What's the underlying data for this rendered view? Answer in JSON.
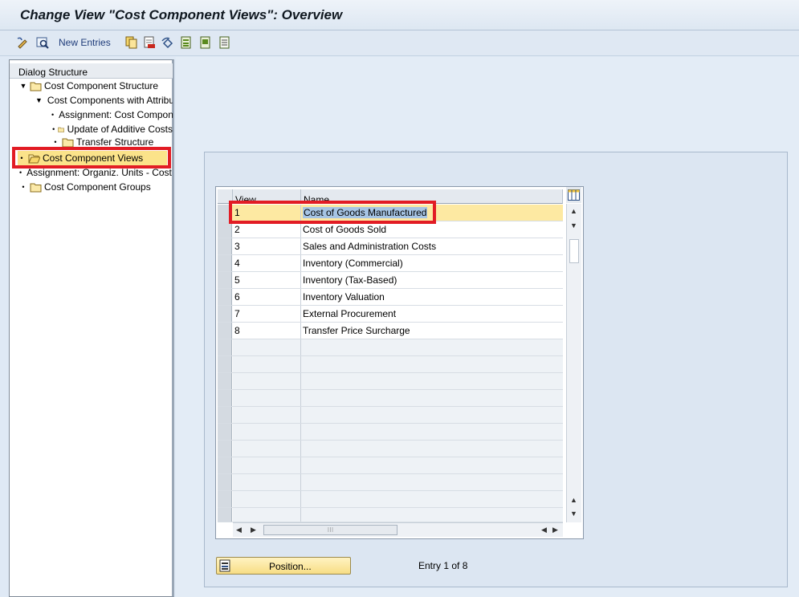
{
  "window": {
    "title": "Change View \"Cost Component Views\": Overview"
  },
  "toolbar": {
    "new_entries_label": "New Entries"
  },
  "dialog_structure": {
    "header": "Dialog Structure",
    "items": [
      {
        "label": "Cost Component Structure",
        "marker": "▼"
      },
      {
        "label": "Cost Components with Attributes",
        "marker": "▼"
      },
      {
        "label": "Assignment: Cost Components",
        "marker": "•"
      },
      {
        "label": "Update of Additive Costs",
        "marker": "•"
      },
      {
        "label": "Transfer Structure",
        "marker": "•"
      },
      {
        "label": "Cost Component Views",
        "marker": "•"
      },
      {
        "label": "Assignment: Organiz. Units - Cost Component Structure",
        "marker": "•"
      },
      {
        "label": "Cost Component Groups",
        "marker": "•"
      }
    ]
  },
  "table": {
    "columns": [
      "View",
      "Name"
    ],
    "rows": [
      {
        "view": "1",
        "name": "Cost of Goods Manufactured"
      },
      {
        "view": "2",
        "name": "Cost of Goods Sold"
      },
      {
        "view": "3",
        "name": "Sales and Administration Costs"
      },
      {
        "view": "4",
        "name": "Inventory (Commercial)"
      },
      {
        "view": "5",
        "name": "Inventory (Tax-Based)"
      },
      {
        "view": "6",
        "name": "Inventory Valuation"
      },
      {
        "view": "7",
        "name": "External Procurement"
      },
      {
        "view": "8",
        "name": "Transfer Price Surcharge"
      }
    ]
  },
  "footer": {
    "position_button_label": "Position...",
    "entry_info": "Entry 1 of 8"
  }
}
